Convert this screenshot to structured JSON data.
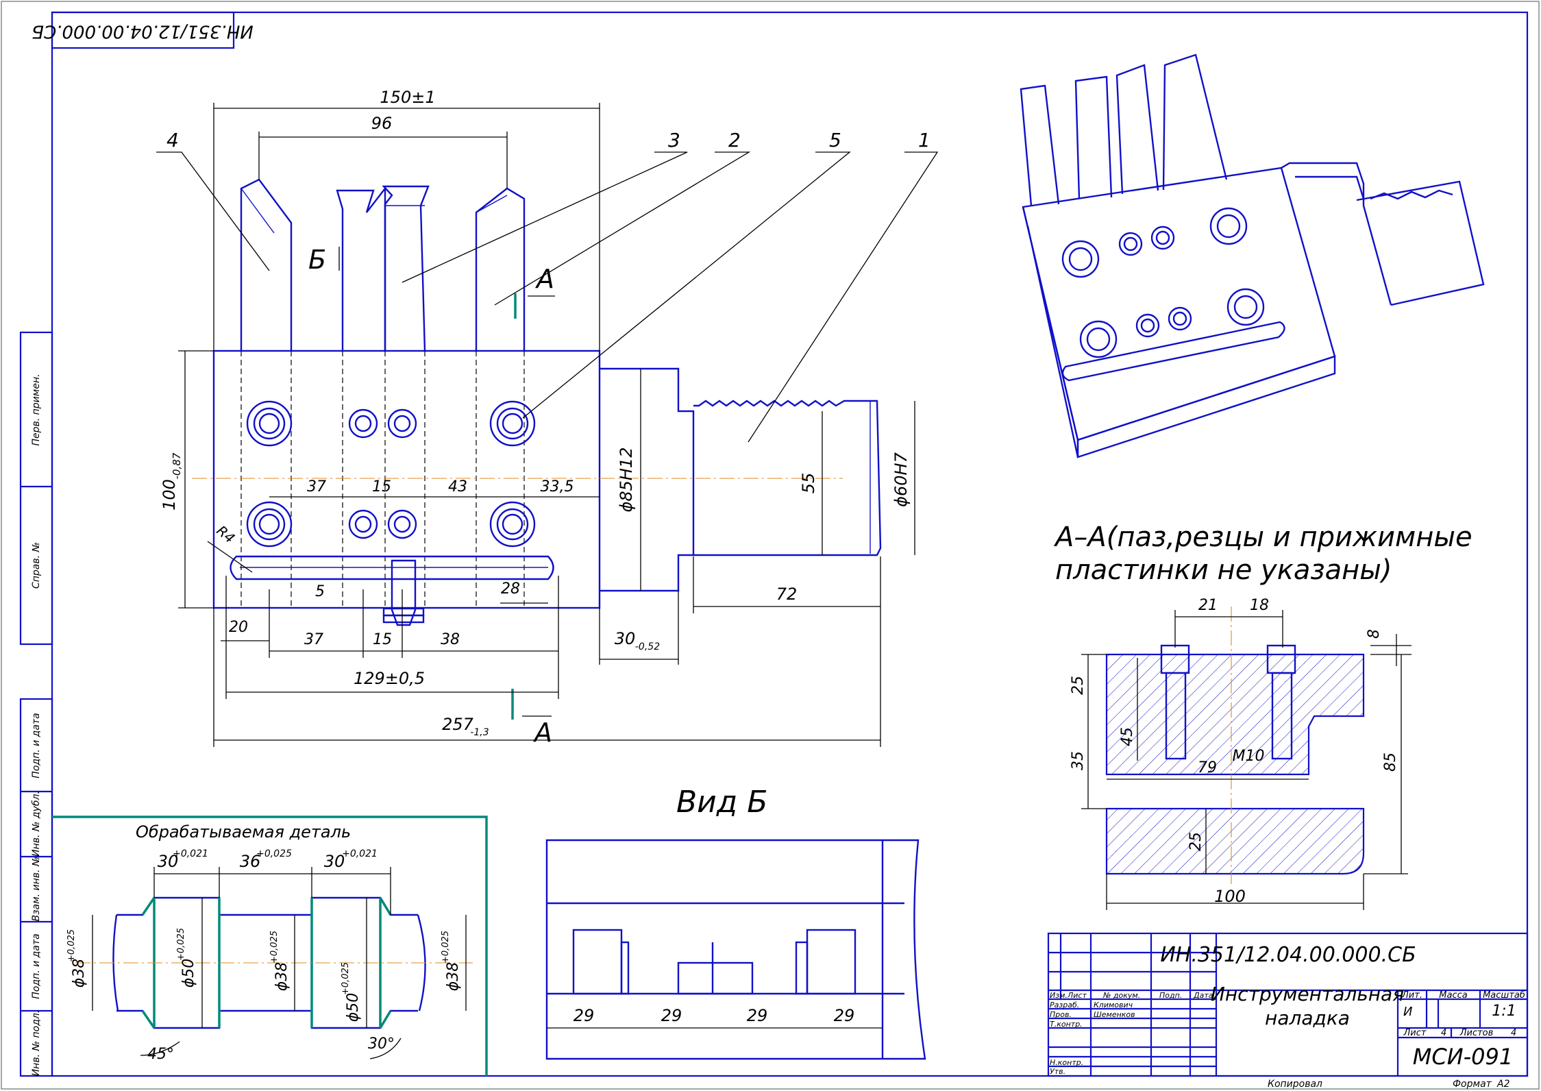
{
  "document": {
    "stamp_rotated": "ИН.351/12.04.00.000.СБ",
    "designation": "ИН.351/12.04.00.000.СБ",
    "title_line1": "Инструментальная",
    "title_line2": "наладка",
    "code": "МСИ-091",
    "scale_label": "Масштаб",
    "scale": "1:1",
    "mass_label": "Масса",
    "lit_label": "Лит.",
    "lit_value": "И",
    "sheet_label": "Лист",
    "sheet": "4",
    "sheets_label": "Листов",
    "sheets": "4",
    "copied": "Копировал",
    "format_label": "Формат",
    "format": "A2"
  },
  "title_block_rows": {
    "header": [
      "Изм.",
      "Лист",
      "№ докум.",
      "Подп.",
      "Дата"
    ],
    "razrab_label": "Разраб.",
    "razrab_name": "Климович",
    "prov_label": "Пров.",
    "prov_name": "Шеменков",
    "tkontr_label": "Т.контр.",
    "nkontr_label": "Н.контр.",
    "utv_label": "Утв."
  },
  "side_stamps": [
    "Перв. примен.",
    "Справ. №",
    "Подп. и дата",
    "Инв. № дубл.",
    "Взам. инв. №",
    "Подп. и дата",
    "Инв. № подл."
  ],
  "main_view": {
    "leaders": [
      "4",
      "3",
      "2",
      "5",
      "1"
    ],
    "view_mark_b": "Б",
    "section_mark": "А",
    "dims": {
      "overall_top": "150±1",
      "span_96": "96",
      "height": "100",
      "height_tol": "-0,87",
      "d85": "ϕ85H12",
      "d55": "55",
      "d60": "ϕ60H7",
      "len72": "72",
      "len30": "30",
      "len30_tol": "-0,52",
      "r4": "R4",
      "row_37a": "37",
      "row_15a": "15",
      "row_43": "43",
      "row_33": "33,5",
      "bot_20": "20",
      "bot_5": "5",
      "bot_37": "37",
      "bot_15": "15",
      "bot_38": "38",
      "bot_28": "28",
      "len129": "129±0,5",
      "len257": "257",
      "len257_tol": "-1,3"
    }
  },
  "section_aa": {
    "title_line1": "А–А(паз,резцы и прижимные",
    "title_line2": "пластинки не указаны)",
    "dims": {
      "d21": "21",
      "d18": "18",
      "d8": "8",
      "d25a": "25",
      "d45": "45",
      "d35": "35",
      "d79": "79",
      "m10": "M10",
      "d85": "85",
      "d25b": "25",
      "d100": "100"
    }
  },
  "view_b": {
    "title": "Вид Б",
    "dims": [
      "29",
      "29",
      "29",
      "29"
    ]
  },
  "workpiece": {
    "title": "Обрабатываемая деталь",
    "dims": {
      "l30a": "30",
      "l30a_tol": "+0,021",
      "l36": "36",
      "l36_tol": "+0,025",
      "l30b": "30",
      "l30b_tol": "+0,021",
      "d38a": "ϕ38",
      "d38a_tol": "+0,025",
      "d50a": "ϕ50",
      "d50a_tol": "+0,025",
      "d38b": "ϕ38",
      "d38b_tol": "+0,025",
      "d50b": "ϕ50",
      "d50b_tol": "+0,025",
      "d38c": "ϕ38",
      "d38c_tol": "+0,025",
      "ang45": "45°",
      "ang30": "30°"
    }
  }
}
